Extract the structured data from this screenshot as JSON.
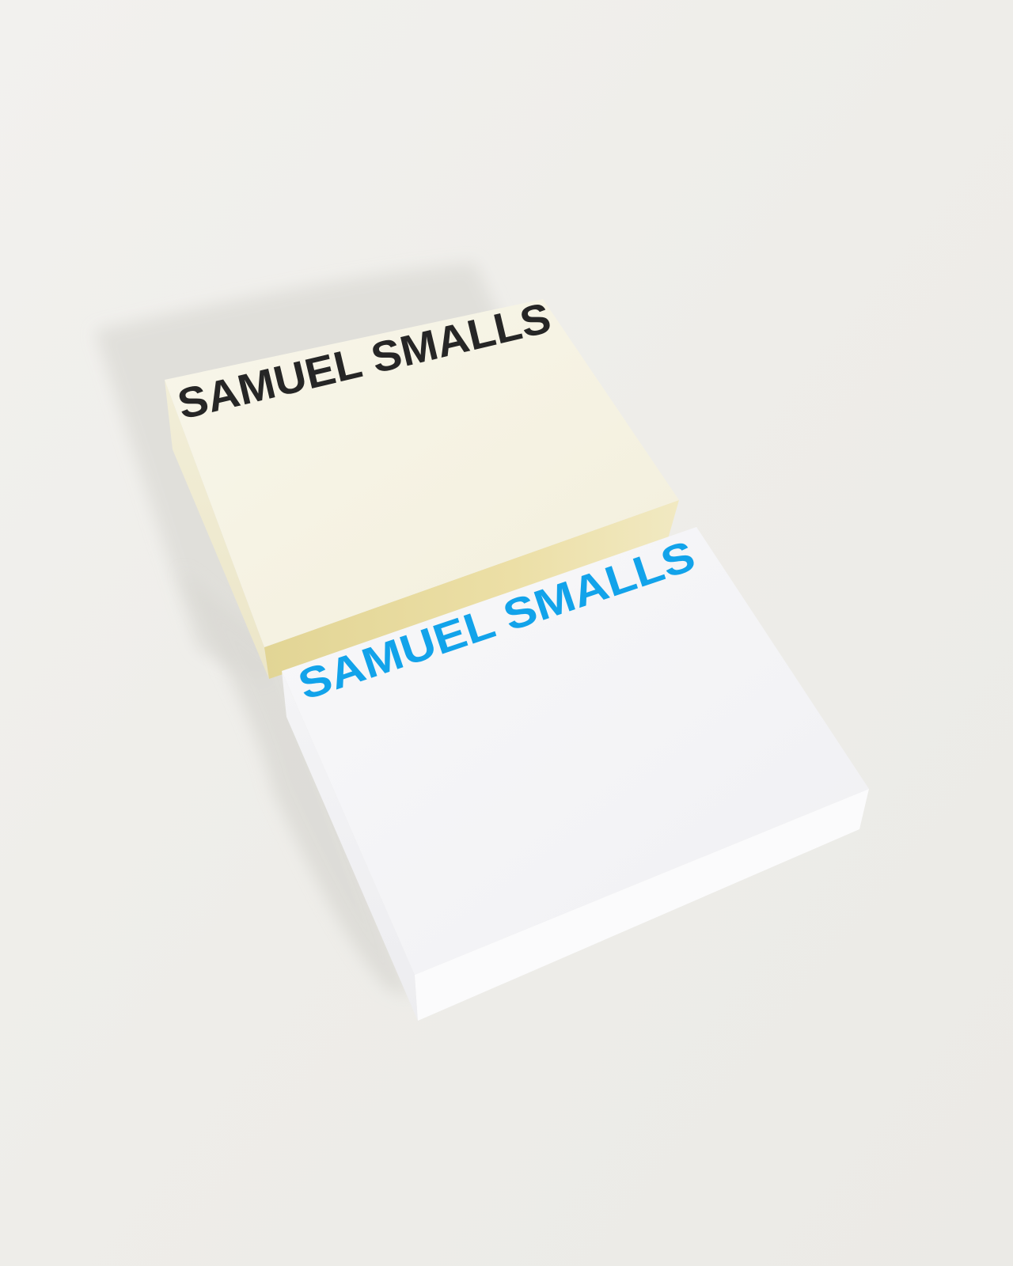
{
  "photo": {
    "background_color": "#efeeeb",
    "notepads": [
      {
        "label": "SAMUEL SMALLS",
        "paper_color": "#f7f4e6",
        "edge_color": "#e8dfb0",
        "text_color": "#262626"
      },
      {
        "label": "SAMUEL SMALLS",
        "paper_color": "#f6f6f8",
        "edge_color": "#fbfbfc",
        "text_color": "#12a3ea"
      }
    ]
  }
}
